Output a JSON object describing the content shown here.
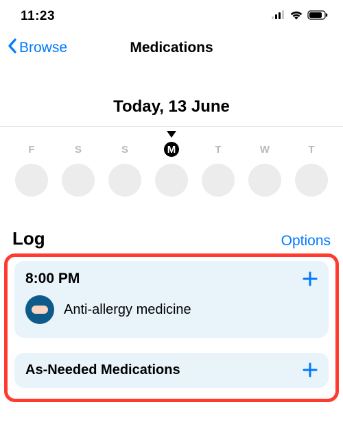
{
  "status": {
    "time": "11:23"
  },
  "nav": {
    "back_label": "Browse",
    "title": "Medications"
  },
  "date_heading": "Today, 13 June",
  "week": {
    "days": [
      "F",
      "S",
      "S",
      "M",
      "T",
      "W",
      "T"
    ],
    "active_index": 3
  },
  "log": {
    "title": "Log",
    "options_label": "Options"
  },
  "entries": {
    "scheduled": {
      "time_label": "8:00 PM",
      "items": [
        {
          "name": "Anti-allergy medicine",
          "icon": "pill"
        }
      ]
    },
    "as_needed": {
      "title": "As-Needed Medications"
    }
  },
  "colors": {
    "accent": "#007AFF",
    "highlight_border": "#FF3B30",
    "card_bg": "#E8F3FA",
    "pill_bg": "#0E5A8A"
  }
}
